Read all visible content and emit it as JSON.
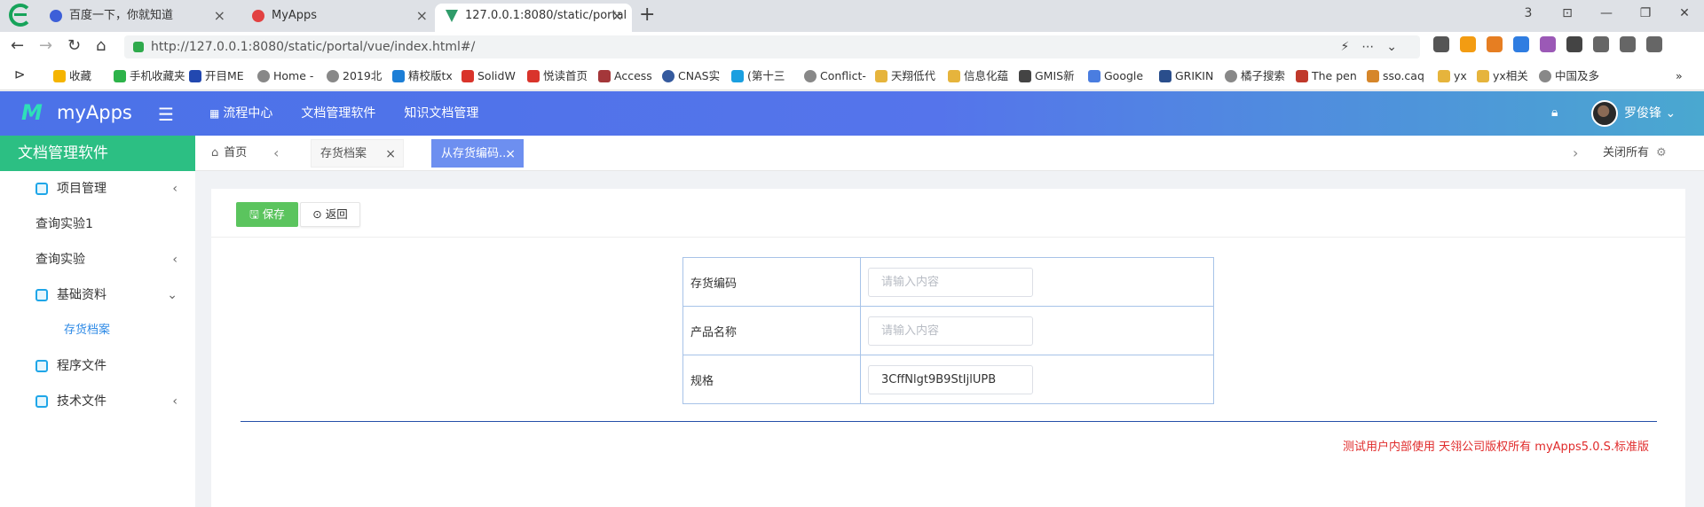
{
  "browser": {
    "tabs": [
      {
        "title": "百度一下，你就知道",
        "favicon_color": "#3d5fd8"
      },
      {
        "title": "MyApps",
        "favicon_color": "#e24141"
      },
      {
        "title": "127.0.0.1:8080/static/portal",
        "favicon_color": "#2f9c6a"
      }
    ],
    "new_tab": "+",
    "window_controls": [
      "3",
      "⊡",
      "—",
      "❐",
      "✕"
    ],
    "nav": {
      "back": "←",
      "forward": "→",
      "reload": "↻",
      "home": "⌂"
    },
    "url": "http://127.0.0.1:8080/static/portal/vue/index.html#/",
    "url_right_icons": "⚡⋯⌄",
    "bookmarks": [
      {
        "label": "收藏",
        "color": "#f5b400"
      },
      {
        "label": "手机收藏夹",
        "color": "#2db34a"
      },
      {
        "label": "开目ME",
        "color": "#2248b0"
      },
      {
        "label": "Home -",
        "color": "#888888"
      },
      {
        "label": "2019北",
        "color": "#888888"
      },
      {
        "label": "精校版tx",
        "color": "#1c7ed6"
      },
      {
        "label": "SolidW",
        "color": "#d9342b"
      },
      {
        "label": "悦读首页",
        "color": "#d9342b"
      },
      {
        "label": "Access",
        "color": "#a4373a"
      },
      {
        "label": "CNAS实",
        "color": "#355a9e"
      },
      {
        "label": "(第十三",
        "color": "#1a9fe0"
      },
      {
        "label": "Conflict-",
        "color": "#888888"
      },
      {
        "label": "天翔低代",
        "color": "#e6b43c"
      },
      {
        "label": "信息化蕴",
        "color": "#e6b43c"
      },
      {
        "label": "GMIS新",
        "color": "#444444"
      },
      {
        "label": "Google",
        "color": "#4a7de0"
      },
      {
        "label": "GRIKIN",
        "color": "#2a4e8c"
      },
      {
        "label": "橘子搜索",
        "color": "#888888"
      },
      {
        "label": "The pen",
        "color": "#c0392b"
      },
      {
        "label": "sso.caq",
        "color": "#d6862a"
      },
      {
        "label": "yx",
        "color": "#e6b43c"
      },
      {
        "label": "yx相关",
        "color": "#e6b43c"
      },
      {
        "label": "中国及多",
        "color": "#888888"
      }
    ]
  },
  "app": {
    "logo": "M",
    "name": "myApps",
    "menu_toggle": "☰",
    "top_nav": [
      "流程中心",
      "文档管理软件",
      "知识文档管理"
    ],
    "user": "罗俊锋",
    "user_chevron": "⌄"
  },
  "sidebar": {
    "title": "文档管理软件",
    "items": [
      {
        "label": "项目管理",
        "icon": "module-icon",
        "chevron": "‹"
      },
      {
        "label": "查询实验1",
        "icon": "",
        "chevron": ""
      },
      {
        "label": "查询实验",
        "icon": "",
        "chevron": "‹"
      },
      {
        "label": "基础资料",
        "icon": "module-icon",
        "chevron": "⌄"
      },
      {
        "label": "存货档案",
        "icon": "",
        "chevron": ""
      },
      {
        "label": "程序文件",
        "icon": "module-icon",
        "chevron": ""
      },
      {
        "label": "技术文件",
        "icon": "module-icon",
        "chevron": "‹"
      }
    ]
  },
  "tags": {
    "home": "首页",
    "prev": "‹",
    "next": "›",
    "tabs": [
      {
        "label": "存货档案",
        "close": "×"
      },
      {
        "label": "从存货编码...",
        "close": "×"
      }
    ],
    "close_all": "关闭所有",
    "settings": "⚙"
  },
  "toolbar": {
    "save_label": "保存",
    "back_label": "返回"
  },
  "form": {
    "fields": [
      {
        "label": "存货编码",
        "value": "",
        "placeholder": "请输入内容"
      },
      {
        "label": "产品名称",
        "value": "",
        "placeholder": "请输入内容"
      },
      {
        "label": "规格",
        "value": "3CffNlgt9B9StIjlUPB",
        "placeholder": ""
      }
    ]
  },
  "footer": {
    "copyright": "测试用户内部使用 天翎公司版权所有 myApps5.0.S.标准版"
  },
  "colors": {
    "header_start": "#4b72e8",
    "header_end": "#4aa8d0",
    "sidebar_title": "#2cbf83",
    "save_button": "#5bc45e",
    "active_tag": "#6d8ff0",
    "copyright": "#e02b2b"
  }
}
